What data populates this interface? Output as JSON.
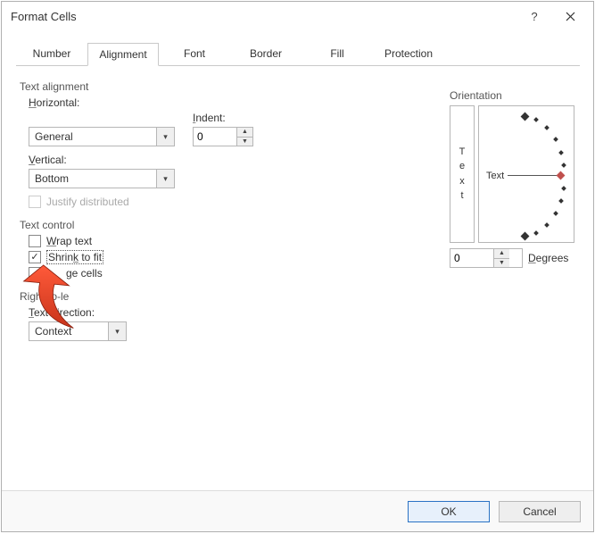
{
  "title": "Format Cells",
  "tabs": [
    "Number",
    "Alignment",
    "Font",
    "Border",
    "Fill",
    "Protection"
  ],
  "active_tab": "Alignment",
  "text_alignment": {
    "title": "Text alignment",
    "horizontal_label": "Horizontal:",
    "horizontal_value": "General",
    "indent_label": "Indent:",
    "indent_value": "0",
    "vertical_label": "Vertical:",
    "vertical_value": "Bottom",
    "justify_label": "Justify distributed"
  },
  "text_control": {
    "title": "Text control",
    "wrap_label": "Wrap text",
    "wrap_checked": false,
    "shrink_label": "Shrink to fit",
    "shrink_checked": true,
    "merge_label": "ge cells",
    "merge_checked": false
  },
  "rtl": {
    "title": "Right-to-le",
    "direction_label": "Text direction:",
    "direction_value": "Context"
  },
  "orientation": {
    "title": "Orientation",
    "text_vertical": "Text",
    "text_label": "Text",
    "degrees_value": "0",
    "degrees_label": "Degrees"
  },
  "buttons": {
    "ok": "OK",
    "cancel": "Cancel"
  }
}
